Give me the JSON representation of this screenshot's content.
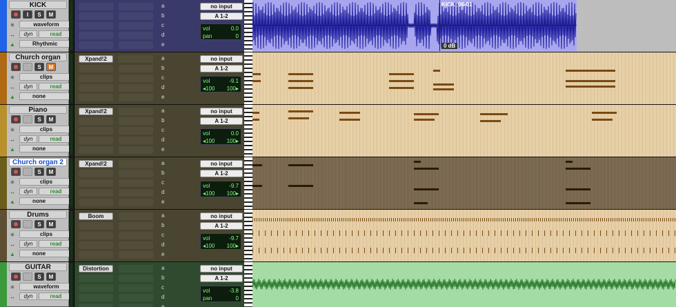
{
  "colors": {
    "kick": "#1e63e8",
    "church_organ": "#b06a14",
    "piano": "#b8912c",
    "church_organ2": "#6b5e1c",
    "drums": "#5e4e32",
    "guitar": "#3a9a3a",
    "midi_bg": "#e7cfa6",
    "midi_note": "#7a4a12",
    "audio_bg": "#a8a6ee",
    "audio_wave": "#1a1a9a",
    "guitar_bg": "#a5dca5",
    "guitar_wave": "#2e7a2e"
  },
  "tracks": [
    {
      "id": "kick",
      "name": "KICK",
      "selected": false,
      "mute_active": false,
      "view": "waveform",
      "dyn": "dyn",
      "automation": "read",
      "group": "Rhythmic",
      "insert": "",
      "io_in": "no input",
      "io_out": "A 1-2",
      "vol_label": "vol",
      "vol": "0.0",
      "pan_label": "pan",
      "pan": "0",
      "sends": [
        "a",
        "b",
        "c",
        "d",
        "e"
      ],
      "clip": {
        "name": "KICK_06-01",
        "gain": "0 dB"
      }
    },
    {
      "id": "church_organ",
      "name": "Church organ",
      "selected": false,
      "mute_active": true,
      "view": "clips",
      "dyn": "dyn",
      "automation": "read",
      "group": "none",
      "insert": "Xpand!2",
      "io_in": "no input",
      "io_out": "A 1-2",
      "vol_label": "vol",
      "vol": "-9.1",
      "pan_l": "◂100",
      "pan_r": "100▸",
      "sends": [
        "a",
        "b",
        "c",
        "d",
        "e"
      ]
    },
    {
      "id": "piano",
      "name": "Piano",
      "selected": false,
      "mute_active": false,
      "view": "clips",
      "dyn": "dyn",
      "automation": "read",
      "group": "none",
      "insert": "Xpand!2",
      "io_in": "no input",
      "io_out": "A 1-2",
      "vol_label": "vol",
      "vol": "0.0",
      "pan_l": "◂100",
      "pan_r": "100▸",
      "sends": [
        "a",
        "b",
        "c",
        "d",
        "e"
      ]
    },
    {
      "id": "church_organ2",
      "name": "Church organ 2",
      "selected": true,
      "mute_active": false,
      "view": "clips",
      "dyn": "dyn",
      "automation": "read",
      "group": "none",
      "insert": "Xpand!2",
      "io_in": "no input",
      "io_out": "A 1-2",
      "vol_label": "vol",
      "vol": "-9.7",
      "pan_l": "◂100",
      "pan_r": "100▸",
      "sends": [
        "a",
        "b",
        "c",
        "d",
        "e"
      ]
    },
    {
      "id": "drums",
      "name": "Drums",
      "selected": false,
      "mute_active": false,
      "view": "clips",
      "dyn": "dyn",
      "automation": "read",
      "group": "none",
      "insert": "Boom",
      "io_in": "no input",
      "io_out": "A 1-2",
      "vol_label": "vol",
      "vol": "-9.7",
      "pan_l": "◂100",
      "pan_r": "100▸",
      "sends": [
        "a",
        "b",
        "c",
        "d",
        "e"
      ]
    },
    {
      "id": "guitar",
      "name": "GUITAR",
      "selected": false,
      "mute_active": false,
      "view": "waveform",
      "dyn": "dyn",
      "automation": "read",
      "group": "",
      "insert": "Distortion",
      "io_in": "no input",
      "io_out": "A 1-2",
      "vol_label": "vol",
      "vol": "-3.8",
      "pan_label": "pan",
      "pan": "0",
      "sends": [
        "a",
        "b",
        "c",
        "d",
        "e"
      ]
    }
  ],
  "buttons": {
    "input": "I",
    "solo": "S",
    "mute": "M"
  }
}
